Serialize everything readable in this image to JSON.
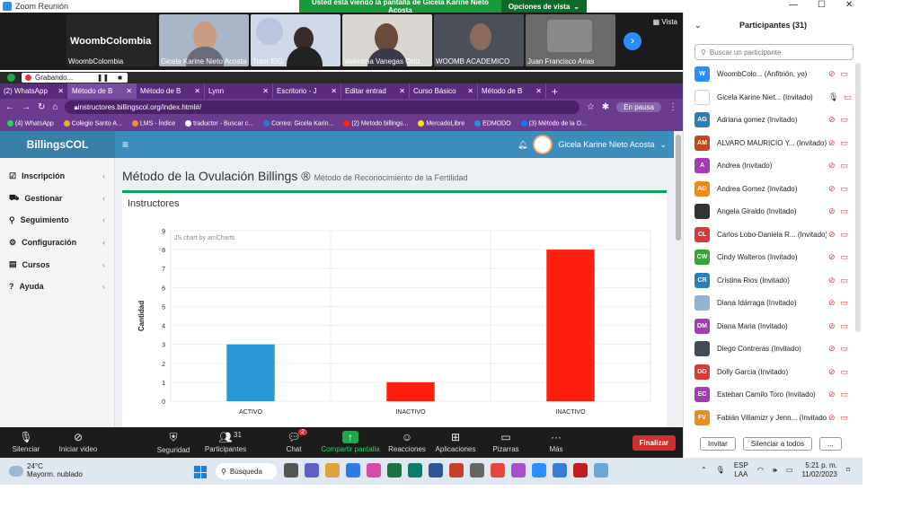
{
  "zoom": {
    "window_title": "Zoom Reunión",
    "share_banner": "Usted está viendo la pantalla de Gicela Karine Nieto Acosta",
    "view_options": "Opciones de vista",
    "vista_label": "Vista",
    "recording_label": "Grabando...",
    "video_tiles": [
      {
        "name": "WoombColombia",
        "brand_text": "WoombColombia"
      },
      {
        "name": "Gicela Karine Nieto Acosta"
      },
      {
        "name": "Tutor EIG"
      },
      {
        "name": "Valentina Vanegas Ortiz"
      },
      {
        "name": "WOOMB ACADEMICO"
      },
      {
        "name": "Juan Francisco Arias"
      }
    ],
    "toolbar": [
      {
        "label": "Silenciar",
        "icon": "mic-icon"
      },
      {
        "label": "Iniciar video",
        "icon": "video-off-icon"
      },
      {
        "label": "Seguridad",
        "icon": "shield-icon"
      },
      {
        "label": "Participantes",
        "icon": "people-icon",
        "count": "31"
      },
      {
        "label": "Chat",
        "icon": "chat-icon",
        "badge": "2"
      },
      {
        "label": "Compartir pantalla",
        "icon": "share-icon"
      },
      {
        "label": "Reacciones",
        "icon": "smile-icon"
      },
      {
        "label": "Aplicaciones",
        "icon": "apps-icon"
      },
      {
        "label": "Pizarras",
        "icon": "whiteboard-icon"
      },
      {
        "label": "Más",
        "icon": "more-icon"
      }
    ],
    "end_button": "Finalizar"
  },
  "browser": {
    "tabs": [
      "(2) WhatsApp",
      "Método de B",
      "Método de B",
      "Lynn",
      "Escritorio - J",
      "Editar entrad",
      "Curso Básico",
      "Método de B"
    ],
    "url": "instructores.billingscol.org/index.html#/",
    "pause_label": "En pausa",
    "bookmarks": [
      "(4) WhatsApp",
      "Colegio Santo A...",
      "LMS - Índice",
      "traductor - Buscar c...",
      "Correo: Gicela Karin...",
      "(2) Metodo billings...",
      "MercadoLibre",
      "EDMODO",
      "(3) Método de la O..."
    ]
  },
  "app": {
    "brand": "BillingsCOL",
    "user_name": "Gicela Karine Nieto Acosta",
    "sidebar": [
      {
        "label": "Inscripción",
        "icon": "check-square-icon"
      },
      {
        "label": "Gestionar",
        "icon": "truck-icon"
      },
      {
        "label": "Seguimiento",
        "icon": "search-icon"
      },
      {
        "label": "Configuración",
        "icon": "cogs-icon"
      },
      {
        "label": "Cursos",
        "icon": "book-icon"
      },
      {
        "label": "Ayuda",
        "icon": "question-icon"
      }
    ],
    "page_title": "Método de la Ovulación Billings ®",
    "page_subtitle": "Método de Reconocimiento de la Fertilidad",
    "box_title": "Instructores"
  },
  "chart_data": {
    "type": "bar",
    "categories": [
      "ACTIVO",
      "INACTIVO",
      "INACTIVO"
    ],
    "values": [
      3,
      1,
      8
    ],
    "colors": [
      "#2a96d4",
      "#ff1f0f",
      "#ff1f0f"
    ],
    "ylabel": "Cantidad",
    "xlabel": "",
    "ylim": [
      0,
      9
    ],
    "yticks": [
      0,
      1,
      2,
      3,
      4,
      5,
      6,
      7,
      8,
      9
    ],
    "watermark": "JS chart by amCharts",
    "grid": true
  },
  "participants": {
    "title": "Participantes (31)",
    "search_placeholder": "Buscar un participante",
    "list": [
      {
        "initials": "W",
        "name": "WoombColo...",
        "role": "(Anfitrión, yo)",
        "color": "#2d8cff"
      },
      {
        "initials": "",
        "name": "Gicela Karine Niet...",
        "role": "(Invitado)",
        "color": "#ffffff",
        "mic_on": true
      },
      {
        "initials": "AG",
        "name": "Adriana gomez",
        "role": "(Invitado)",
        "color": "#2d7fb8"
      },
      {
        "initials": "AM",
        "name": "ALVARO MAURICIO Y...",
        "role": "(Invitado)",
        "color": "#c9451c"
      },
      {
        "initials": "A",
        "name": "Andrea",
        "role": "(Invitado)",
        "color": "#a43ab5"
      },
      {
        "initials": "AG",
        "name": "Andrea Gomez",
        "role": "(Invitado)",
        "color": "#f08a1b"
      },
      {
        "initials": "",
        "name": "Angela Giraldo",
        "role": "(Invitado)",
        "color": "#333333"
      },
      {
        "initials": "CL",
        "name": "Carlos Lobo-Daniela R...",
        "role": "(Invitado)",
        "color": "#d83a3a"
      },
      {
        "initials": "CW",
        "name": "Cindy Walteros",
        "role": "(Invitado)",
        "color": "#3aa33a"
      },
      {
        "initials": "CR",
        "name": "Cristina Rios",
        "role": "(Invitado)",
        "color": "#2d7fb8"
      },
      {
        "initials": "",
        "name": "Diana Idárraga",
        "role": "(Invitado)",
        "color": "#8fb4d4"
      },
      {
        "initials": "DM",
        "name": "Diana Maria",
        "role": "(Invitado)",
        "color": "#a43ab5"
      },
      {
        "initials": "",
        "name": "Diego Contreras",
        "role": "(Invitado)",
        "color": "#444a5a"
      },
      {
        "initials": "DG",
        "name": "Dolly Garcia",
        "role": "(Invitado)",
        "color": "#d83a3a"
      },
      {
        "initials": "EC",
        "name": "Esteban Camilo Toro",
        "role": "(Invitado)",
        "color": "#a43ab5"
      },
      {
        "initials": "FV",
        "name": "Fabián Villamizr y Jenn...",
        "role": "(Invitado)",
        "color": "#f08a1b"
      }
    ],
    "invite_label": "Invitar",
    "mute_all_label": "Silenciar a todos",
    "more_label": "..."
  },
  "taskbar": {
    "temperature": "24°C",
    "weather": "Mayorm. nublado",
    "search_label": "Búsqueda",
    "language": "ESP",
    "layout": "LAA",
    "time": "5:21 p. m.",
    "date": "11/02/2023"
  }
}
